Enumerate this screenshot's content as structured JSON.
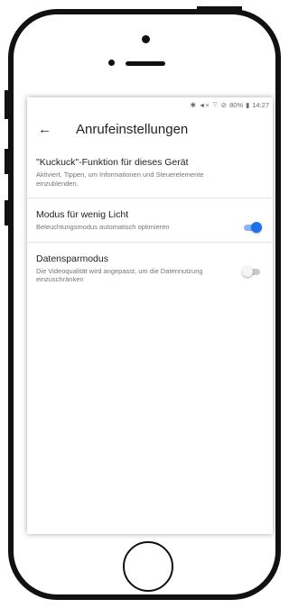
{
  "status_bar": {
    "icons": [
      "bluetooth-icon",
      "mute-icon",
      "wifi-icon",
      "do-not-disturb-icon"
    ],
    "battery": "80%",
    "time": "14:27"
  },
  "app_bar": {
    "back_icon": "arrow-left-icon",
    "title": "Anrufeinstellungen"
  },
  "settings": [
    {
      "title": "\"Kuckuck\"-Funktion für dieses Gerät",
      "subtitle": "Aktiviert. Tippen, um Informationen und Steuerelemente einzublenden."
    },
    {
      "title": "Modus für wenig Licht",
      "subtitle": "Beleuchtungsmodus automatisch optimieren",
      "toggle": true
    },
    {
      "title": "Datensparmodus",
      "subtitle": "Die Videoqualität wird angepasst, um die Datennutzung einzuschränken",
      "toggle": false
    }
  ],
  "colors": {
    "toggle_on": "#1a73e8",
    "toggle_off": "#c9c9c9"
  }
}
